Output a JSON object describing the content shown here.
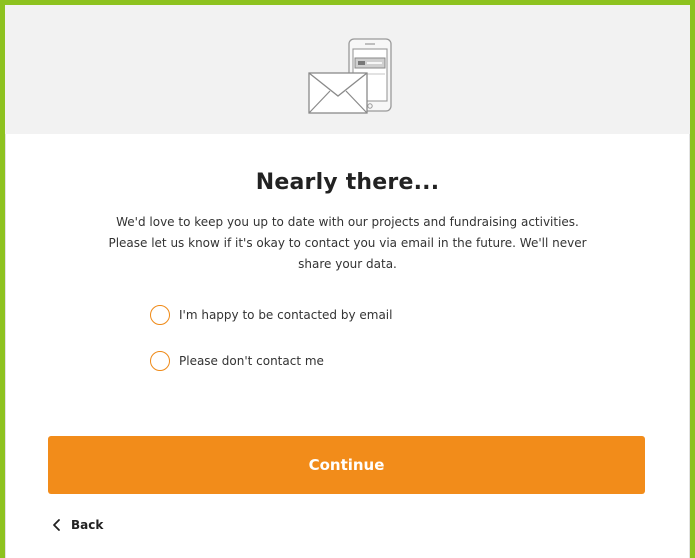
{
  "header": {
    "illustration_icon": "phone-and-envelope-icon"
  },
  "main": {
    "title": "Nearly there...",
    "body_lines": [
      "We'd love to keep you up to date with our projects and fundraising activities.",
      "Please let us know if it's okay to contact you via email in the future. We'll never",
      "share your data."
    ],
    "options": [
      {
        "label": "I'm happy to be contacted by email",
        "selected": false
      },
      {
        "label": "Please don't contact me",
        "selected": false
      }
    ]
  },
  "actions": {
    "continue_label": "Continue",
    "back_label": "Back",
    "back_icon": "chevron-left-icon"
  },
  "colors": {
    "frame_border": "#8dc21f",
    "accent": "#f28c1a",
    "header_background": "#f2f2f2"
  }
}
